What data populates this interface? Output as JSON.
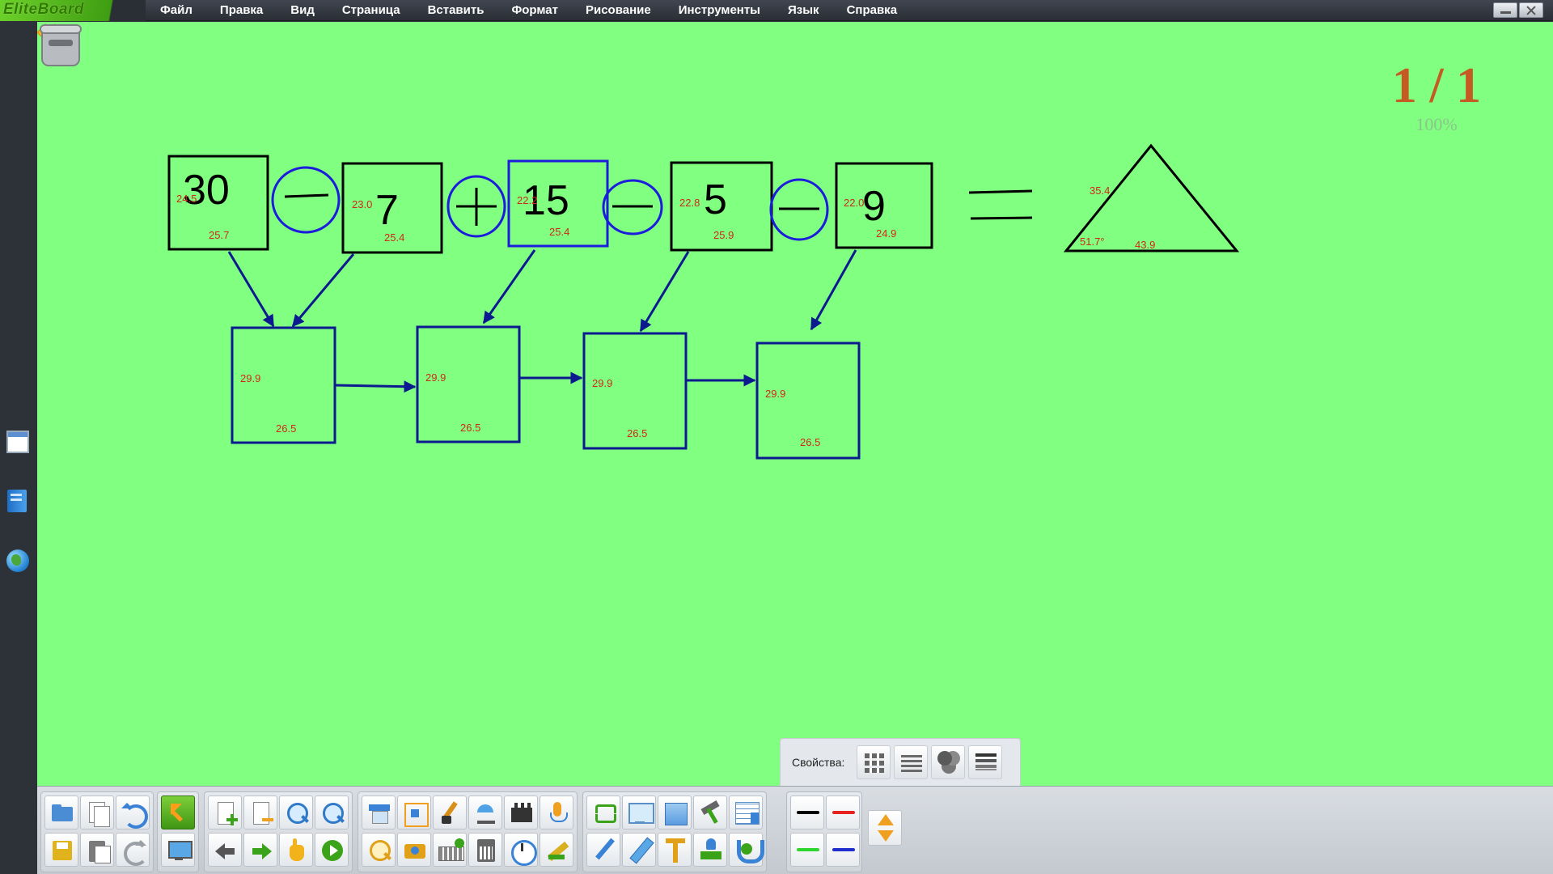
{
  "app": {
    "logo_text": "EliteBoard"
  },
  "menu": [
    "Файл",
    "Правка",
    "Вид",
    "Страница",
    "Вставить",
    "Формат",
    "Рисование",
    "Инструменты",
    "Язык",
    "Справка"
  ],
  "board": {
    "background": "#80ff80",
    "page_counter": "1 / 1",
    "zoom": "100%",
    "equation": {
      "numbers": [
        "30",
        "7",
        "15",
        "5",
        "9"
      ],
      "operators": [
        "minus",
        "plus",
        "minus",
        "minus"
      ],
      "number_box_labels": [
        {
          "side": "24.5",
          "bottom": "25.7"
        },
        {
          "side": "23.0",
          "bottom": "25.4"
        },
        {
          "side": "22.2",
          "bottom": "25.4"
        },
        {
          "side": "22.8",
          "bottom": "25.9"
        },
        {
          "side": "22.0",
          "bottom": "24.9"
        }
      ],
      "result_boxes": [
        {
          "side": "29.9",
          "bottom": "26.5"
        },
        {
          "side": "29.9",
          "bottom": "26.5"
        },
        {
          "side": "29.9",
          "bottom": "26.5"
        },
        {
          "side": "29.9",
          "bottom": "26.5"
        }
      ],
      "triangle_labels": {
        "side": "35.4",
        "angle": "51.7°",
        "base": "43.9"
      }
    }
  },
  "properties": {
    "label": "Свойства:"
  },
  "colors": {
    "stroke_blue": "#0b1a8f",
    "circle_blue": "#1c1cdc",
    "label_red": "#d0281a",
    "accent_orange": "#c55a22"
  },
  "toolbar_icons": {
    "group1": [
      "folder-icon",
      "pages-icon",
      "undo-icon",
      "save-icon",
      "paste-icon",
      "redo-icon"
    ],
    "group2": [
      "select-cursor-icon",
      "screen-icon"
    ],
    "group3": [
      "page-add-icon",
      "page-delete-icon",
      "zoom-in-icon",
      "zoom-out-icon",
      "prev-page-icon",
      "next-page-icon",
      "hand-icon",
      "play-icon"
    ],
    "group4": [
      "screen-shade-icon",
      "fit-icon",
      "brush-icon",
      "spotlight-icon",
      "clapper-icon",
      "mic-icon",
      "magnifier-icon",
      "camera-icon",
      "keyboard-icon",
      "calculator-icon",
      "clock-icon",
      "ruler-icon"
    ],
    "group5": [
      "swap-icon",
      "monitor-icon",
      "blank-page-icon",
      "hammer-icon",
      "table-icon",
      "pen-icon",
      "marker-icon",
      "text-icon",
      "stamp-icon",
      "magnet-icon"
    ],
    "pens": [
      "black",
      "red",
      "green",
      "blue"
    ]
  }
}
